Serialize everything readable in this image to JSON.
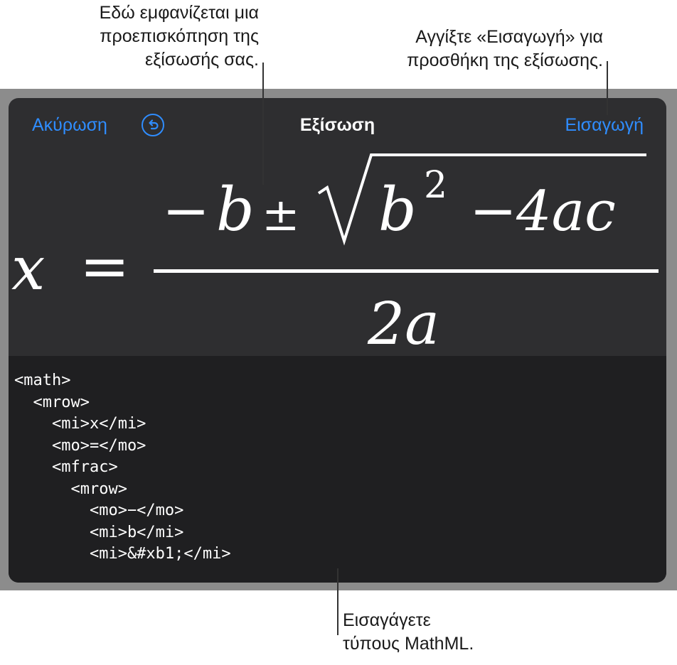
{
  "callouts": {
    "preview": [
      "Εδώ εμφανίζεται μια",
      "προεπισκόπηση της",
      "εξίσωσής σας."
    ],
    "insert": [
      "Αγγίξτε «Εισαγωγή» για",
      "προσθήκη της εξίσωσης."
    ],
    "mathml": [
      "Εισαγάγετε",
      "τύπους MathML."
    ]
  },
  "nav": {
    "cancel_label": "Ακύρωση",
    "undo_icon": "undo-icon",
    "title": "Εξίσωση",
    "insert_label": "Εισαγωγή"
  },
  "preview": {
    "lhs": "x",
    "equals": "=",
    "numerator": {
      "minus": "−",
      "b": "b",
      "plus_minus": "±",
      "radicand_b": "b",
      "exponent": "2",
      "minus2": "−",
      "rest": "4ac"
    },
    "denominator": "2a"
  },
  "editor": {
    "code": "<math>\n  <mrow>\n    <mi>x</mi>\n    <mo>=</mo>\n    <mfrac>\n      <mrow>\n        <mo>−</mo>\n        <mi>b</mi>\n        <mi>&#xb1;</mi>"
  },
  "colors": {
    "accent": "#2f8dff",
    "sheet": "#2e2e30",
    "editor": "#1f1f21",
    "backdrop": "#8c8c8c"
  }
}
